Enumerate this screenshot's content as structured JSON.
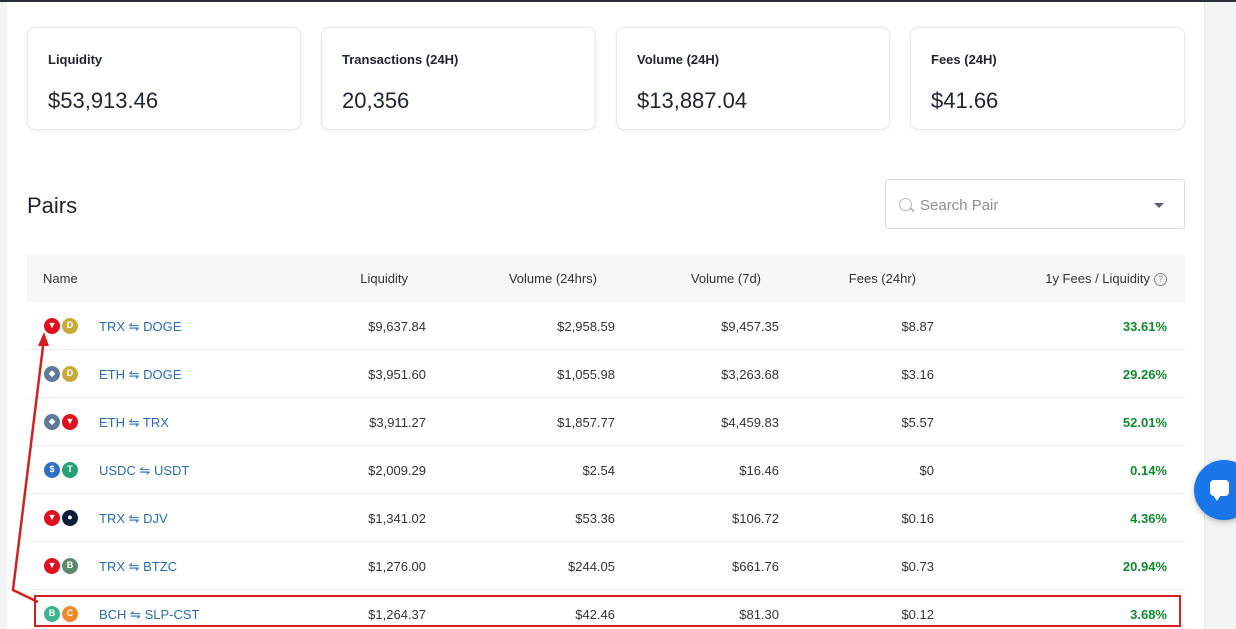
{
  "stats": [
    {
      "label": "Liquidity",
      "value": "$53,913.46"
    },
    {
      "label": "Transactions (24H)",
      "value": "20,356"
    },
    {
      "label": "Volume (24H)",
      "value": "$13,887.04"
    },
    {
      "label": "Fees (24H)",
      "value": "$41.66"
    }
  ],
  "pairs": {
    "title": "Pairs",
    "search_placeholder": "Search Pair",
    "columns": {
      "name": "Name",
      "liquidity": "Liquidity",
      "volume_24h": "Volume (24hrs)",
      "volume_7d": "Volume (7d)",
      "fees_24h": "Fees (24hr)",
      "fees_liquidity": "1y Fees / Liquidity",
      "info_glyph": "?"
    },
    "rows": [
      {
        "pair": "TRX ⇋ DOGE",
        "liquidity": "$9,637.84",
        "vol24": "$2,958.59",
        "vol7": "$9,457.35",
        "fees": "$8.87",
        "ratio": "33.61%",
        "c1": {
          "glyph": "▼",
          "color": "#e0111e"
        },
        "c2": {
          "glyph": "D",
          "color": "#c9a93b"
        }
      },
      {
        "pair": "ETH ⇋ DOGE",
        "liquidity": "$3,951.60",
        "vol24": "$1,055.98",
        "vol7": "$3,263.68",
        "fees": "$3.16",
        "ratio": "29.26%",
        "c1": {
          "glyph": "◆",
          "color": "#5f7a99"
        },
        "c2": {
          "glyph": "D",
          "color": "#c9a93b"
        }
      },
      {
        "pair": "ETH ⇋ TRX",
        "liquidity": "$3,911.27",
        "vol24": "$1,857.77",
        "vol7": "$4,459.83",
        "fees": "$5.57",
        "ratio": "52.01%",
        "c1": {
          "glyph": "◆",
          "color": "#5f7a99"
        },
        "c2": {
          "glyph": "▼",
          "color": "#e0111e"
        }
      },
      {
        "pair": "USDC ⇋ USDT",
        "liquidity": "$2,009.29",
        "vol24": "$2.54",
        "vol7": "$16.46",
        "fees": "$0",
        "ratio": "0.14%",
        "c1": {
          "glyph": "$",
          "color": "#2f70c7"
        },
        "c2": {
          "glyph": "T",
          "color": "#26a17b"
        }
      },
      {
        "pair": "TRX ⇋ DJV",
        "liquidity": "$1,341.02",
        "vol24": "$53.36",
        "vol7": "$106.72",
        "fees": "$0.16",
        "ratio": "4.36%",
        "c1": {
          "glyph": "▼",
          "color": "#e0111e"
        },
        "c2": {
          "glyph": "●",
          "color": "#0c1d3a"
        }
      },
      {
        "pair": "TRX ⇋ BTZC",
        "liquidity": "$1,276.00",
        "vol24": "$244.05",
        "vol7": "$661.76",
        "fees": "$0.73",
        "ratio": "20.94%",
        "c1": {
          "glyph": "▼",
          "color": "#e0111e"
        },
        "c2": {
          "glyph": "B",
          "color": "#5b8a6d"
        }
      },
      {
        "pair": "BCH ⇋ SLP-CST",
        "liquidity": "$1,264.37",
        "vol24": "$42.46",
        "vol7": "$81.30",
        "fees": "$0.12",
        "ratio": "3.68%",
        "c1": {
          "glyph": "B",
          "color": "#3fb58f"
        },
        "c2": {
          "glyph": "C",
          "color": "#f18a2a"
        }
      }
    ]
  },
  "colors": {
    "link": "#2a6db5",
    "positive": "#0f8a2f",
    "annotation": "#d42020",
    "chat": "#1976e8"
  }
}
